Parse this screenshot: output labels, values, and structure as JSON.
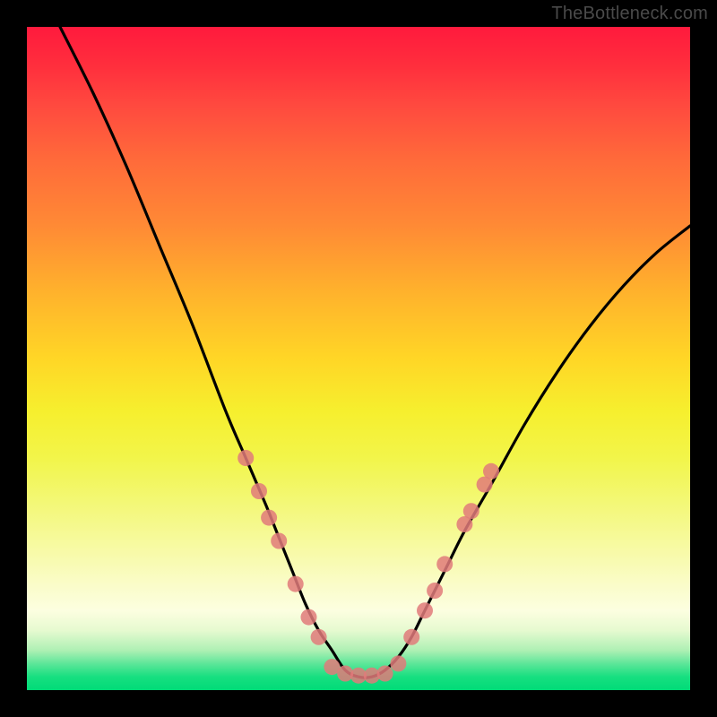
{
  "watermark": "TheBottleneck.com",
  "chart_data": {
    "type": "line",
    "title": "",
    "xlabel": "",
    "ylabel": "",
    "xlim": [
      0,
      100
    ],
    "ylim": [
      0,
      100
    ],
    "grid": false,
    "series": [
      {
        "name": "bottleneck-curve",
        "color": "#000000",
        "x": [
          5,
          10,
          15,
          20,
          25,
          30,
          33,
          36,
          38,
          40,
          42,
          44,
          46,
          48,
          50,
          52,
          54,
          56,
          58,
          60,
          63,
          66,
          70,
          75,
          80,
          85,
          90,
          95,
          100
        ],
        "y": [
          100,
          90,
          79,
          67,
          55,
          42,
          35,
          28,
          23,
          18,
          13,
          9,
          6,
          3,
          2,
          2,
          3,
          5,
          8,
          12,
          18,
          24,
          31,
          40,
          48,
          55,
          61,
          66,
          70
        ]
      }
    ],
    "markers": {
      "name": "highlight-points",
      "color": "#e07a7a",
      "radius_px": 9,
      "points": [
        {
          "x": 33,
          "y": 35
        },
        {
          "x": 35,
          "y": 30
        },
        {
          "x": 36.5,
          "y": 26
        },
        {
          "x": 38,
          "y": 22.5
        },
        {
          "x": 40.5,
          "y": 16
        },
        {
          "x": 42.5,
          "y": 11
        },
        {
          "x": 44,
          "y": 8
        },
        {
          "x": 46,
          "y": 3.5
        },
        {
          "x": 48,
          "y": 2.5
        },
        {
          "x": 50,
          "y": 2.2
        },
        {
          "x": 52,
          "y": 2.2
        },
        {
          "x": 54,
          "y": 2.5
        },
        {
          "x": 56,
          "y": 4
        },
        {
          "x": 58,
          "y": 8
        },
        {
          "x": 60,
          "y": 12
        },
        {
          "x": 61.5,
          "y": 15
        },
        {
          "x": 63,
          "y": 19
        },
        {
          "x": 66,
          "y": 25
        },
        {
          "x": 67,
          "y": 27
        },
        {
          "x": 69,
          "y": 31
        },
        {
          "x": 70,
          "y": 33
        }
      ]
    }
  }
}
